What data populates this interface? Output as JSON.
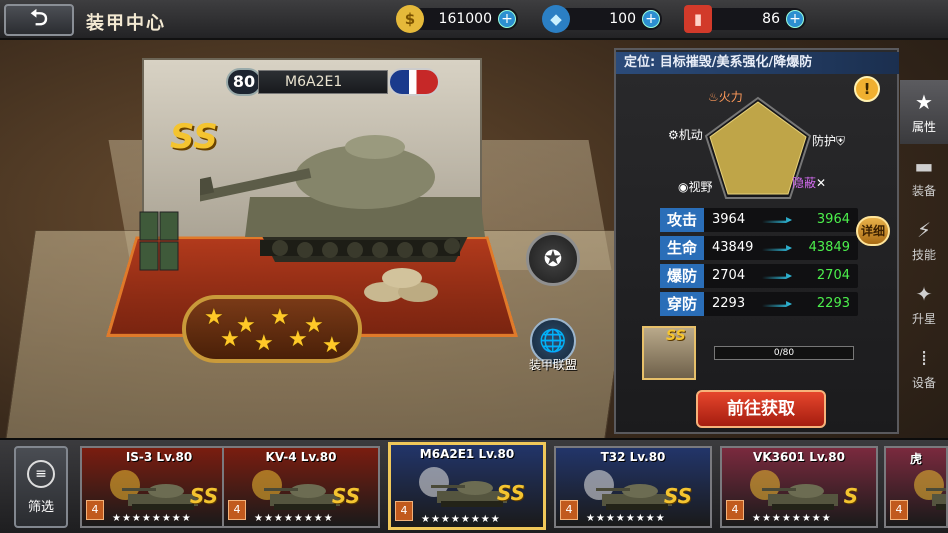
{
  "header": {
    "back_icon": "back-arrow-icon",
    "title": "装甲中心"
  },
  "resources": [
    {
      "name": "coins",
      "icon": "coin-icon",
      "value": "161000",
      "color": "#e5b93a"
    },
    {
      "name": "diamonds",
      "icon": "diamond-icon",
      "value": "100",
      "color": "#6fc6f2"
    },
    {
      "name": "oil",
      "icon": "oil-barrel-icon",
      "value": "86",
      "color": "#d23a2a"
    }
  ],
  "tank": {
    "level": "80",
    "name": "M6A2E1",
    "grade": "SS",
    "stars": 8,
    "nation": "usa"
  },
  "stage_buttons": {
    "skill_icon": "skill-emblem-icon",
    "alliance_label": "装甲联盟"
  },
  "panel": {
    "role": "定位: 目标摧毁/美系强化/降爆防",
    "radar": {
      "firepower": "火力",
      "mobility": "机动",
      "armor": "防护",
      "vision": "视野",
      "stealth": "隐蔽"
    },
    "stats": [
      {
        "name": "攻击",
        "current": "3964",
        "next": "3964"
      },
      {
        "name": "生命",
        "current": "43849",
        "next": "43849"
      },
      {
        "name": "爆防",
        "current": "2704",
        "next": "2704"
      },
      {
        "name": "穿防",
        "current": "2293",
        "next": "2293"
      }
    ],
    "detail_button": "详细",
    "fragment": {
      "grade": "SS",
      "progress_text": "0/80",
      "progress": 0
    },
    "get_button": "前往获取"
  },
  "side_tabs": [
    {
      "label": "属性",
      "icon": "star-icon",
      "active": true
    },
    {
      "label": "装备",
      "icon": "tank-icon",
      "active": false
    },
    {
      "label": "技能",
      "icon": "skill-icon",
      "active": false
    },
    {
      "label": "升星",
      "icon": "upgrade-star-icon",
      "active": false
    },
    {
      "label": "设备",
      "icon": "ammo-icon",
      "active": false
    }
  ],
  "bottom": {
    "filter_label": "筛选",
    "cards": [
      {
        "name": "IS-3 Lv.80",
        "grade": "SS",
        "rank": "4",
        "stars": "★★★★★★★★",
        "bg": "#7a1d10",
        "selected": false
      },
      {
        "name": "KV-4 Lv.80",
        "grade": "SS",
        "rank": "4",
        "stars": "★★★★★★★★",
        "bg": "#7a1d10",
        "selected": false
      },
      {
        "name": "M6A2E1 Lv.80",
        "grade": "SS",
        "rank": "4",
        "stars": "★★★★★★★★",
        "bg": "#22356a",
        "selected": true
      },
      {
        "name": "T32 Lv.80",
        "grade": "SS",
        "rank": "4",
        "stars": "★★★★★★★★",
        "bg": "#22356a",
        "selected": false
      },
      {
        "name": "VK3601 Lv.80",
        "grade": "S",
        "rank": "4",
        "stars": "★★★★★★★★",
        "bg": "#7a2a3e",
        "selected": false
      },
      {
        "name": "虎",
        "grade": "",
        "rank": "4",
        "stars": "",
        "bg": "#7a2a3e",
        "selected": false
      }
    ]
  }
}
